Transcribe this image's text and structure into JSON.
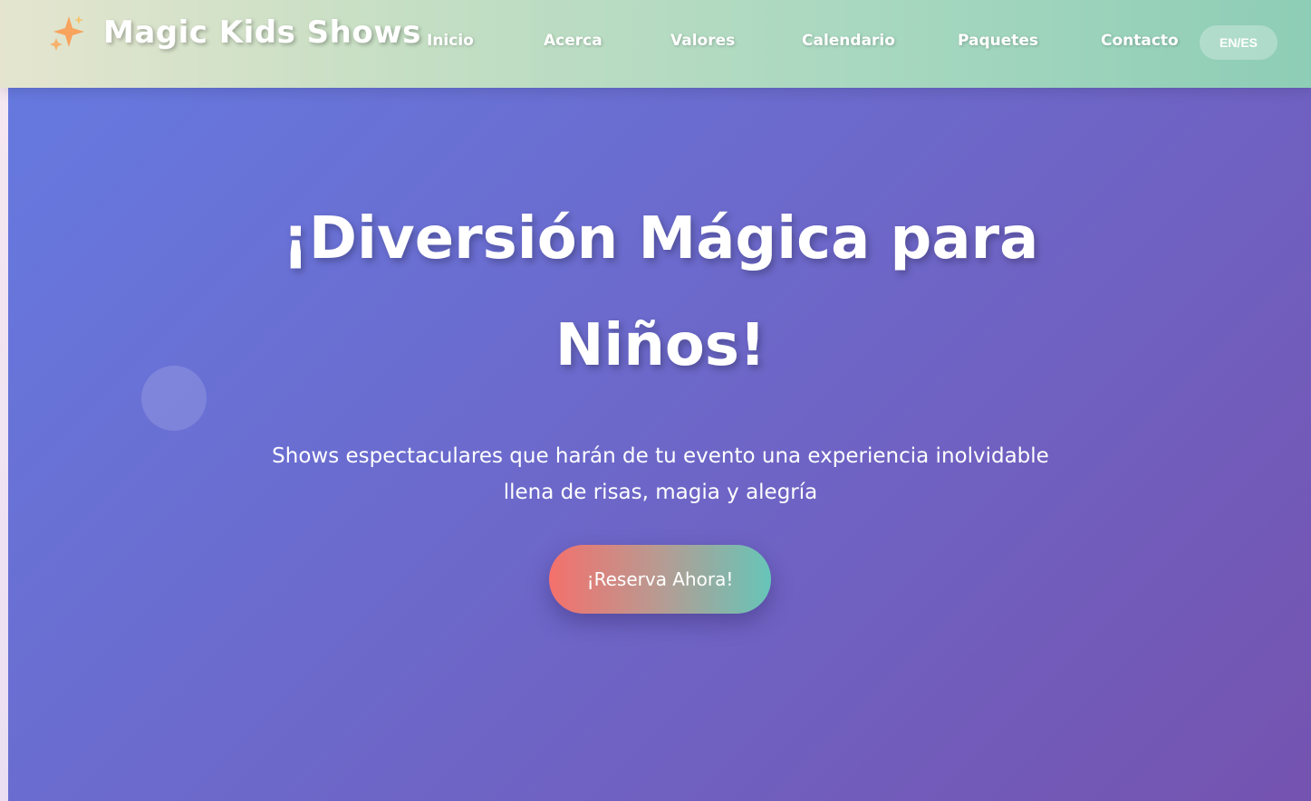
{
  "brand": {
    "icon": "sparkles-icon",
    "title": "Magic Kids Shows"
  },
  "nav": {
    "items": [
      {
        "label": "Inicio"
      },
      {
        "label": "Acerca"
      },
      {
        "label": "Valores"
      },
      {
        "label": "Calendario"
      },
      {
        "label": "Paquetes"
      },
      {
        "label": "Contacto"
      }
    ],
    "language_toggle": "EN/ES"
  },
  "hero": {
    "title_line1": "¡Diversión Mágica para",
    "title_line2": "Niños!",
    "subtitle_line1": "Shows espectaculares que harán de tu evento una experiencia inolvidable",
    "subtitle_line2": "llena de risas, magia y alegría",
    "cta_label": "¡Reserva Ahora!"
  },
  "colors": {
    "hero_gradient_start": "#6679df",
    "hero_gradient_end": "#7553b0",
    "nav_gradient_start": "#e5e5cf",
    "nav_gradient_end": "#8ecdb6",
    "cta_gradient_start": "#f4706c",
    "cta_gradient_end": "#66c5b8"
  }
}
